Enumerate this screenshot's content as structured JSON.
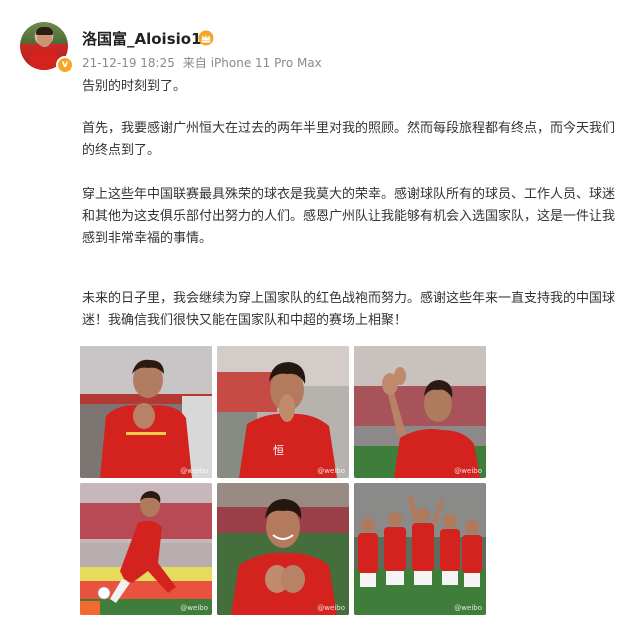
{
  "user": {
    "name": "洛国富_Aloisio19",
    "verified_icon": "verified-badge-icon",
    "badge_icon": "crown-icon",
    "accent": "#f5a623"
  },
  "meta": {
    "date": "21-12-19 18:25",
    "source_prefix": "来自",
    "device": "iPhone 11 Pro Max"
  },
  "post": {
    "p1": "告别的时刻到了。",
    "p2": "首先，我要感谢广州恒大在过去的两年半里对我的照顾。然而每段旅程都有终点，而今天我们的终点到了。",
    "p3": "穿上这些年中国联赛最具殊荣的球衣是我莫大的荣幸。感谢球队所有的球员、工作人员、球迷和其他为这支俱乐部付出努力的人们。感恩广州队让我能够有机会入选国家队，这是一件让我感到非常幸福的事情。",
    "p4": "未来的日子里，我会继续为穿上国家队的红色战袍而努力。感谢这些年来一直支持我的中国球迷！我确信我们很快又能在国家队和中超的赛场上相聚！"
  },
  "photos": [
    {
      "name": "photo-1",
      "kind": "hands-clasped"
    },
    {
      "name": "photo-2",
      "kind": "praying"
    },
    {
      "name": "photo-3",
      "kind": "clapping"
    },
    {
      "name": "photo-4",
      "kind": "kicking"
    },
    {
      "name": "photo-5",
      "kind": "smiling"
    },
    {
      "name": "photo-6",
      "kind": "celebration"
    }
  ],
  "colors": {
    "jersey_red": "#d4221e",
    "pitch_green": "#3f7d3a",
    "meta_gray": "#8a8a8a"
  }
}
